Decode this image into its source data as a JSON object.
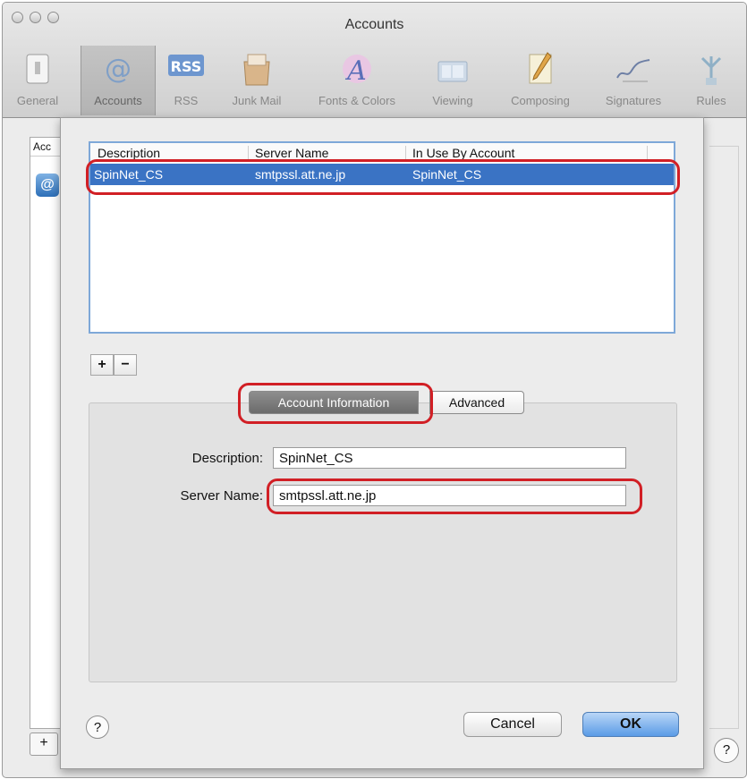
{
  "window": {
    "title": "Accounts"
  },
  "toolbar": {
    "items": [
      {
        "label": "General",
        "icon": "general-switch-icon"
      },
      {
        "label": "Accounts",
        "icon": "at-sign-icon",
        "selected": true
      },
      {
        "label": "RSS",
        "icon": "rss-icon"
      },
      {
        "label": "Junk Mail",
        "icon": "junk-mail-icon"
      },
      {
        "label": "Fonts & Colors",
        "icon": "fonts-colors-icon"
      },
      {
        "label": "Viewing",
        "icon": "viewing-icon"
      },
      {
        "label": "Composing",
        "icon": "composing-icon"
      },
      {
        "label": "Signatures",
        "icon": "signature-icon"
      },
      {
        "label": "Rules",
        "icon": "rules-icon"
      }
    ]
  },
  "background": {
    "sidebar_header": "Acc"
  },
  "smtp_table": {
    "columns": [
      "Description",
      "Server Name",
      "In Use By Account"
    ],
    "rows": [
      {
        "description": "SpinNet_CS",
        "server_name": "smtpssl.att.ne.jp",
        "in_use_by": "SpinNet_CS"
      }
    ]
  },
  "list_controls": {
    "add": "+",
    "remove": "−"
  },
  "tabs": {
    "active": "Account Information",
    "inactive": "Advanced"
  },
  "form": {
    "description_label": "Description:",
    "description_value": "SpinNet_CS",
    "server_label": "Server Name:",
    "server_value": "smtpssl.att.ne.jp"
  },
  "buttons": {
    "help": "?",
    "cancel": "Cancel",
    "ok": "OK"
  },
  "colors": {
    "selection": "#3a73c4",
    "highlight": "#d11f25",
    "default_button": "#5a9be6"
  }
}
